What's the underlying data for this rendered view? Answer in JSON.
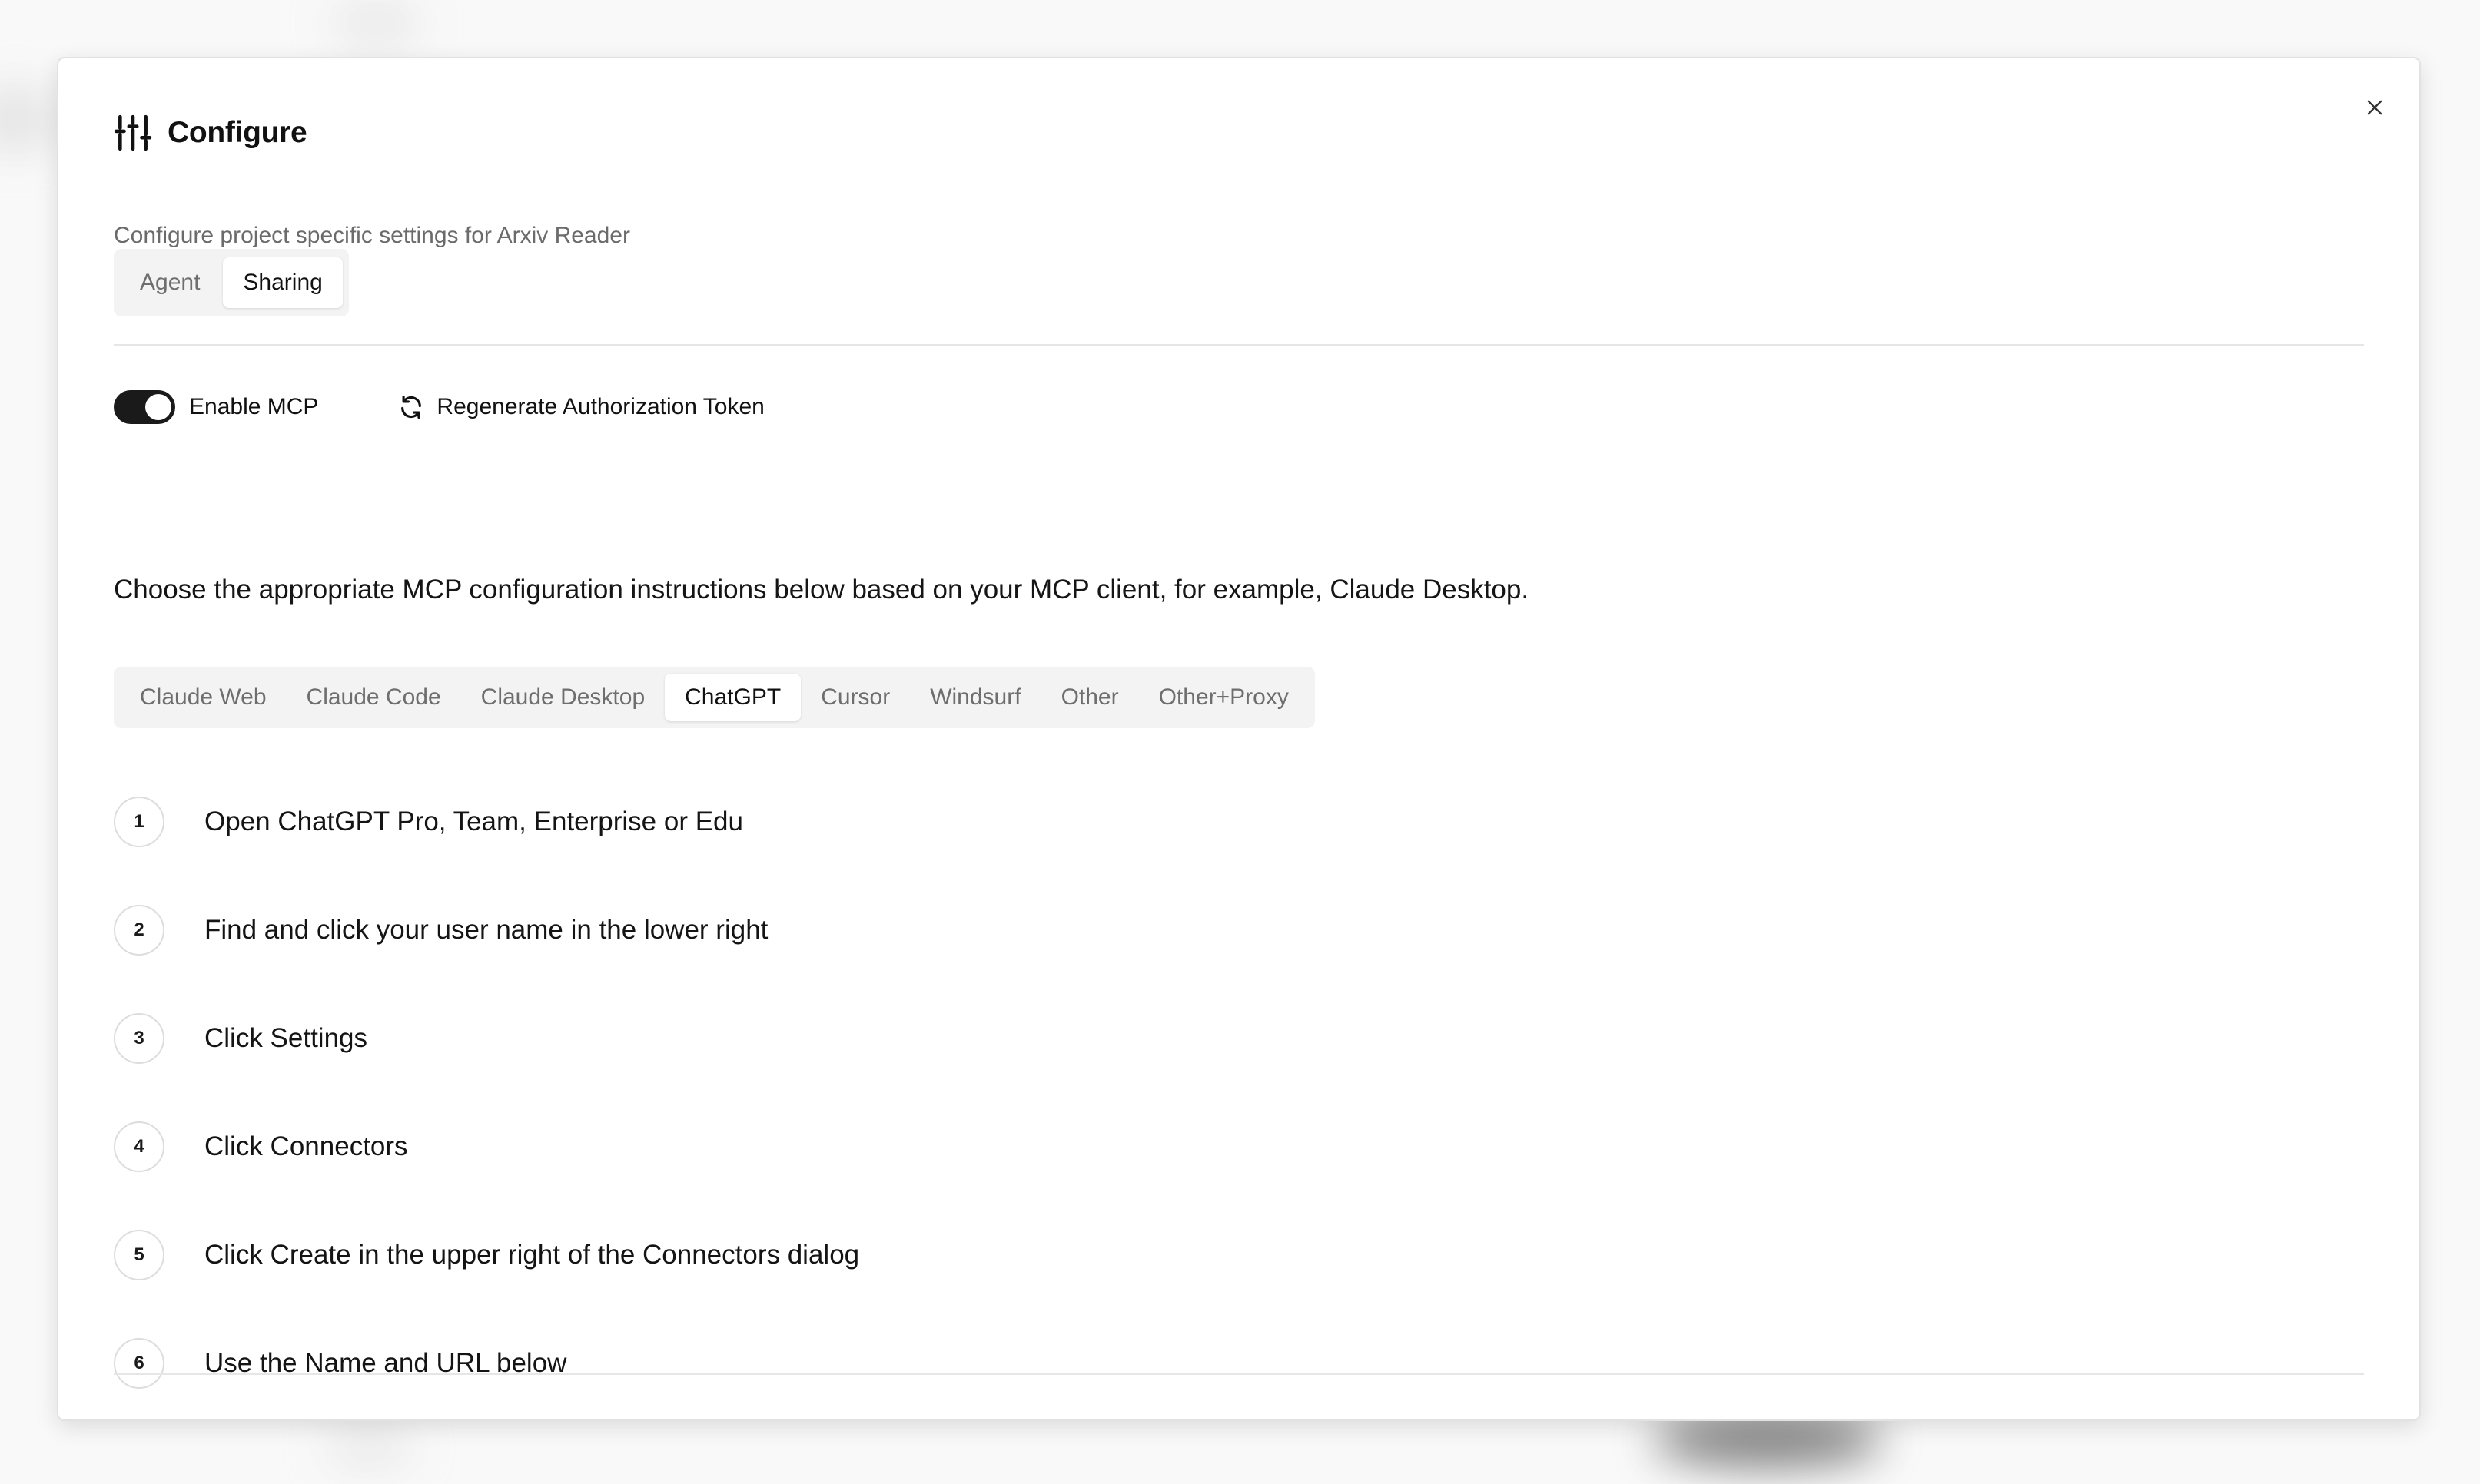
{
  "dialog": {
    "title": "Configure",
    "subtitle": "Configure project specific settings for Arxiv Reader",
    "close_icon": "close-icon",
    "title_icon": "sliders-icon"
  },
  "top_tabs": [
    {
      "label": "Agent",
      "active": false
    },
    {
      "label": "Sharing",
      "active": true
    }
  ],
  "mcp": {
    "toggle_label": "Enable MCP",
    "toggle_on": true,
    "regenerate_label": "Regenerate Authorization Token",
    "regenerate_icon": "refresh-icon"
  },
  "instructions": "Choose the appropriate MCP configuration instructions below based on your MCP client, for example, Claude Desktop.",
  "client_tabs": [
    {
      "label": "Claude Web",
      "active": false
    },
    {
      "label": "Claude Code",
      "active": false
    },
    {
      "label": "Claude Desktop",
      "active": false
    },
    {
      "label": "ChatGPT",
      "active": true
    },
    {
      "label": "Cursor",
      "active": false
    },
    {
      "label": "Windsurf",
      "active": false
    },
    {
      "label": "Other",
      "active": false
    },
    {
      "label": "Other+Proxy",
      "active": false
    }
  ],
  "steps": [
    {
      "num": "1",
      "text": "Open ChatGPT Pro, Team, Enterprise or Edu"
    },
    {
      "num": "2",
      "text": "Find and click your user name in the lower right"
    },
    {
      "num": "3",
      "text": "Click Settings"
    },
    {
      "num": "4",
      "text": "Click Connectors"
    },
    {
      "num": "5",
      "text": "Click Create in the upper right of the Connectors dialog"
    },
    {
      "num": "6",
      "text": "Use the Name and URL below"
    }
  ],
  "colors": {
    "toggle_on": "#1a1a1a",
    "tab_bg": "#f3f3f3",
    "muted_text": "#6e6e6e"
  }
}
